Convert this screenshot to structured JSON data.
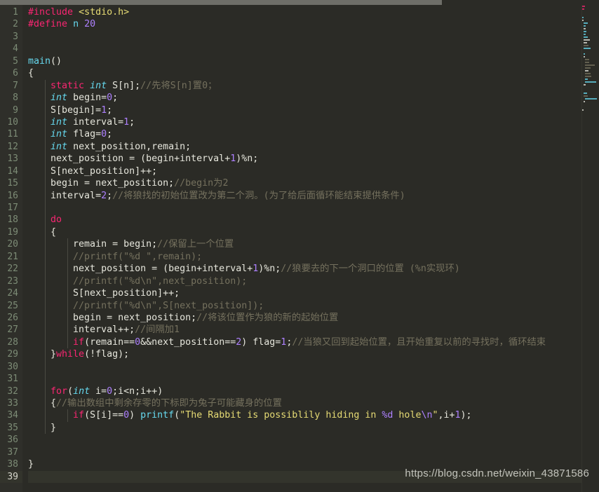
{
  "window": {
    "title": "C source code editor",
    "theme": "monokai-dark",
    "background_color": "#2b2b26",
    "gutter_color": "#2f2f2a",
    "active_line_color": "#33342c",
    "total_lines": 39,
    "active_line": 39
  },
  "watermark": {
    "text": "https://blog.csdn.net/weixin_43871586"
  },
  "colors": {
    "keyword": "#f92672",
    "type": "#66d9ef",
    "function": "#66d9ef",
    "string": "#e6db74",
    "number": "#ae81ff",
    "comment": "#75715e",
    "plain": "#e6e6dc",
    "line_number": "#7d8c76",
    "line_number_active": "#d6d6cc"
  },
  "line_numbers": [
    1,
    2,
    3,
    4,
    5,
    6,
    7,
    8,
    9,
    10,
    11,
    12,
    13,
    14,
    15,
    16,
    17,
    18,
    19,
    20,
    21,
    22,
    23,
    24,
    25,
    26,
    27,
    28,
    29,
    30,
    31,
    32,
    33,
    34,
    35,
    36,
    37,
    38,
    39
  ],
  "code": {
    "lines": [
      {
        "n": 1,
        "text": "#include <stdio.h>"
      },
      {
        "n": 2,
        "text": "#define n 20"
      },
      {
        "n": 3,
        "text": ""
      },
      {
        "n": 4,
        "text": ""
      },
      {
        "n": 5,
        "text": "main()"
      },
      {
        "n": 6,
        "text": "{"
      },
      {
        "n": 7,
        "text": "    static int S[n];//先将S[n]置0；"
      },
      {
        "n": 8,
        "text": "    int begin=0;"
      },
      {
        "n": 9,
        "text": "    S[begin]=1;"
      },
      {
        "n": 10,
        "text": "    int interval=1;"
      },
      {
        "n": 11,
        "text": "    int flag=0;"
      },
      {
        "n": 12,
        "text": "    int next_position,remain;"
      },
      {
        "n": 13,
        "text": "    next_position = (begin+interval+1)%n;"
      },
      {
        "n": 14,
        "text": "    S[next_position]++;"
      },
      {
        "n": 15,
        "text": "    begin = next_position;//begin为2"
      },
      {
        "n": 16,
        "text": "    interval=2;//将狼找的初始位置改为第二个洞。(为了给后面循环能结束提供条件)"
      },
      {
        "n": 17,
        "text": ""
      },
      {
        "n": 18,
        "text": "    do"
      },
      {
        "n": 19,
        "text": "    {"
      },
      {
        "n": 20,
        "text": "        remain = begin;//保留上一个位置"
      },
      {
        "n": 21,
        "text": "        //printf(\"%d \",remain);"
      },
      {
        "n": 22,
        "text": "        next_position = (begin+interval+1)%n;//狼要去的下一个洞口的位置 (%n实现环)"
      },
      {
        "n": 23,
        "text": "        //printf(\"%d\\n\",next_position);"
      },
      {
        "n": 24,
        "text": "        S[next_position]++;"
      },
      {
        "n": 25,
        "text": "        //printf(\"%d\\n\",S[next_position]);"
      },
      {
        "n": 26,
        "text": "        begin = next_position;//将该位置作为狼的新的起始位置"
      },
      {
        "n": 27,
        "text": "        interval++;//间隔加1"
      },
      {
        "n": 28,
        "text": "        if(remain==0&&next_position==2) flag=1;//当狼又回到起始位置，且开始重复以前的寻找时，循环结束"
      },
      {
        "n": 29,
        "text": "    }while(!flag);"
      },
      {
        "n": 30,
        "text": ""
      },
      {
        "n": 31,
        "text": ""
      },
      {
        "n": 32,
        "text": "    for(int i=0;i<n;i++)"
      },
      {
        "n": 33,
        "text": "    {//输出数组中剩余存零的下标即为兔子可能藏身的位置"
      },
      {
        "n": 34,
        "text": "        if(S[i]==0) printf(\"The Rabbit is possiblily hiding in %d hole\\n\",i+1);"
      },
      {
        "n": 35,
        "text": "    }"
      },
      {
        "n": 36,
        "text": ""
      },
      {
        "n": 37,
        "text": ""
      },
      {
        "n": 38,
        "text": "}"
      },
      {
        "n": 39,
        "text": ""
      }
    ]
  }
}
